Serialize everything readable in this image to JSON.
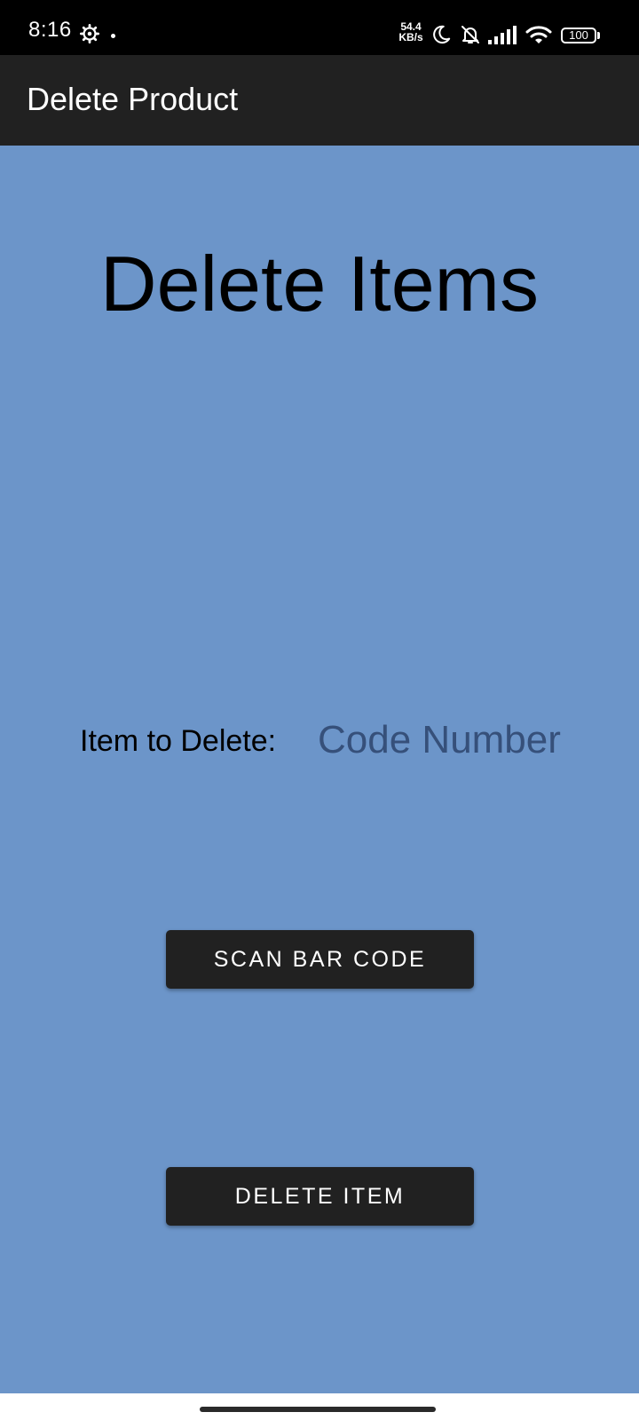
{
  "status_bar": {
    "time": "8:16",
    "net_speed_value": "54.4",
    "net_speed_unit": "KB/s",
    "battery": "100",
    "icons": [
      "gear-icon",
      "moon-icon",
      "bell-off-icon",
      "signal-icon",
      "wifi-icon",
      "battery-icon"
    ]
  },
  "app_bar": {
    "title": "Delete Product"
  },
  "main": {
    "heading": "Delete Items",
    "item_label": "Item to Delete:",
    "code_input": {
      "value": "",
      "placeholder": "Code Number"
    },
    "scan_button_label": "SCAN BAR CODE",
    "delete_button_label": "DELETE ITEM"
  },
  "colors": {
    "background": "#6c95c9",
    "app_bar": "#212121",
    "button": "#212121",
    "button_text": "#ffffff",
    "placeholder_text": "#36507a"
  }
}
